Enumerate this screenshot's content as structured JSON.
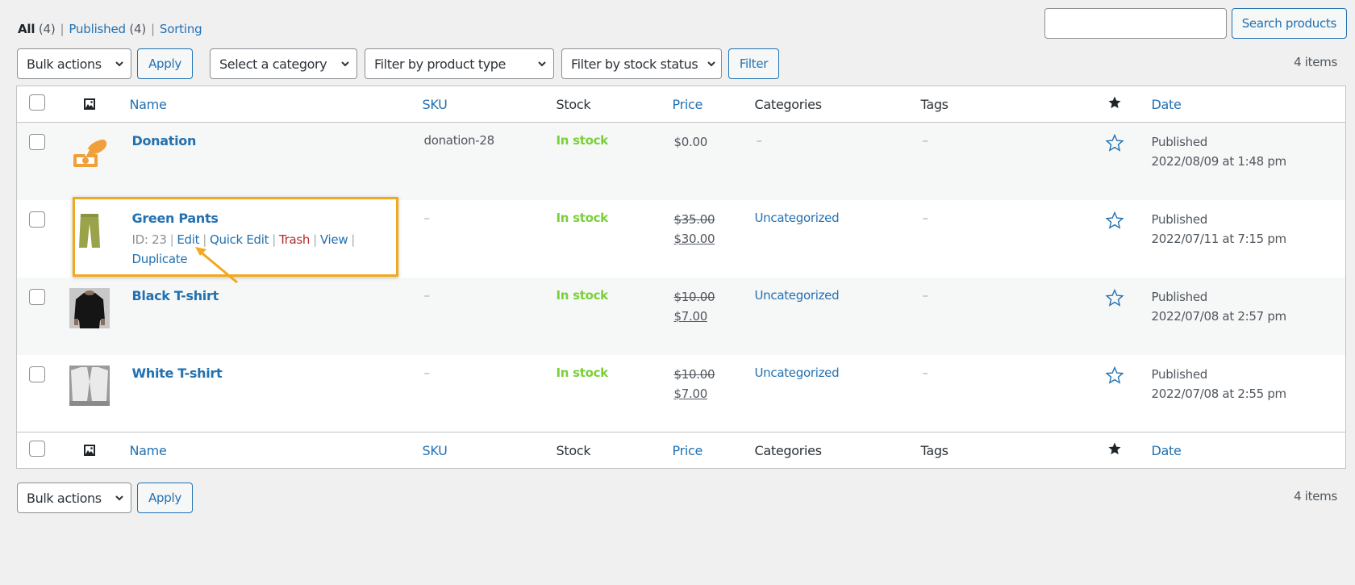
{
  "views": {
    "all_label": "All",
    "all_count": "(4)",
    "published_label": "Published",
    "published_count": "(4)",
    "sorting_label": "Sorting",
    "separator": "|"
  },
  "search": {
    "value": "",
    "placeholder": "",
    "button_label": "Search products"
  },
  "tablenav_top": {
    "bulk_actions": "Bulk actions",
    "apply_label": "Apply",
    "category_filter": "Select a category",
    "product_type_filter": "Filter by product type",
    "stock_status_filter": "Filter by stock status",
    "filter_label": "Filter",
    "items_count": "4 items"
  },
  "tablenav_bottom": {
    "bulk_actions": "Bulk actions",
    "apply_label": "Apply",
    "items_count": "4 items"
  },
  "columns": {
    "thumb_icon": "image-icon",
    "name": "Name",
    "sku": "SKU",
    "stock": "Stock",
    "price": "Price",
    "categories": "Categories",
    "tags": "Tags",
    "featured_icon": "star-filled-icon",
    "date": "Date"
  },
  "products": [
    {
      "name": "Donation",
      "thumb": "donation-hand-icon",
      "sku": "donation-28",
      "stock": "In stock",
      "regular_price": "",
      "price": "$0.00",
      "categories": "–",
      "tags": "–",
      "featured": false,
      "status": "Published",
      "date": "2022/08/09 at 1:48 pm"
    },
    {
      "name": "Green Pants",
      "thumb": "green-pants",
      "sku": "–",
      "stock": "In stock",
      "regular_price": "$35.00",
      "price": "$30.00",
      "categories": "Uncategorized",
      "tags": "–",
      "featured": false,
      "status": "Published",
      "date": "2022/07/11 at 7:15 pm",
      "row_actions": {
        "id": "ID: 23",
        "edit": "Edit",
        "quick_edit": "Quick Edit",
        "trash": "Trash",
        "view": "View",
        "duplicate": "Duplicate",
        "separator": "|"
      }
    },
    {
      "name": "Black T-shirt",
      "thumb": "black-tshirt",
      "sku": "–",
      "stock": "In stock",
      "regular_price": "$10.00",
      "price": "$7.00",
      "categories": "Uncategorized",
      "tags": "–",
      "featured": false,
      "status": "Published",
      "date": "2022/07/08 at 2:57 pm"
    },
    {
      "name": "White T-shirt",
      "thumb": "white-tshirt",
      "sku": "–",
      "stock": "In stock",
      "regular_price": "$10.00",
      "price": "$7.00",
      "categories": "Uncategorized",
      "tags": "–",
      "featured": false,
      "status": "Published",
      "date": "2022/07/08 at 2:55 pm"
    }
  ],
  "colors": {
    "link": "#2271b1",
    "in_stock": "#7ad03a",
    "trash": "#b32d2e",
    "highlight": "#f0a91e",
    "background": "#f0f0f1"
  }
}
